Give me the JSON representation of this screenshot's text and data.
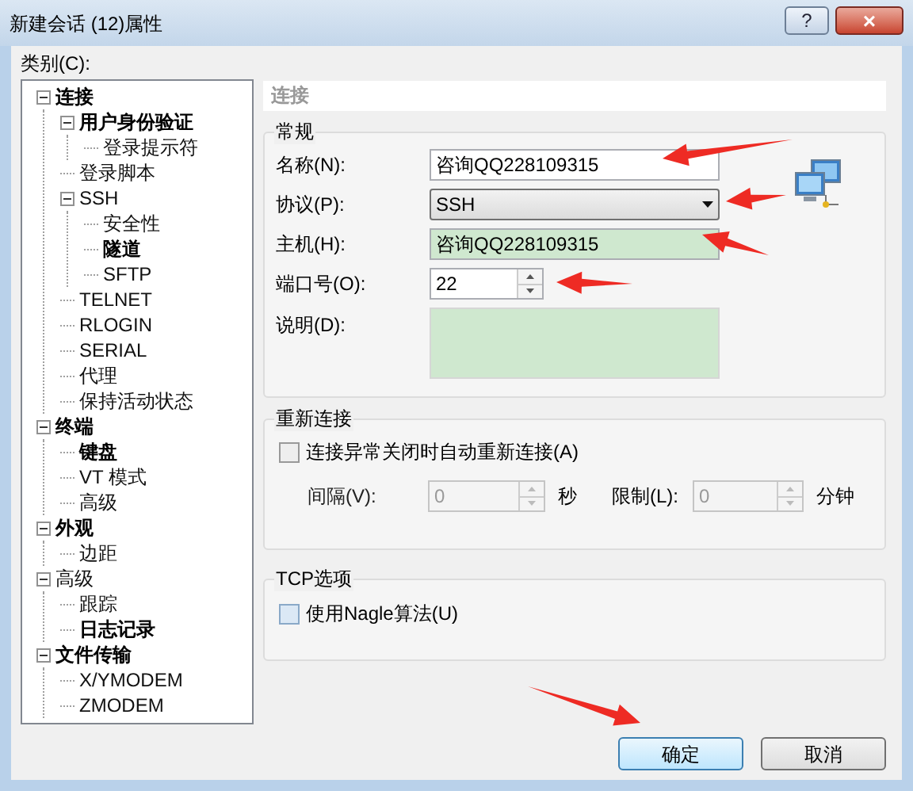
{
  "window": {
    "title": "新建会话 (12)属性",
    "help_button": "?",
    "close_button": "×"
  },
  "category_label": "类别(C):",
  "tree": [
    {
      "label": "连接",
      "bold": true,
      "expanded": true,
      "children": [
        {
          "label": "用户身份验证",
          "bold": true,
          "expanded": true,
          "children": [
            {
              "label": "登录提示符",
              "bold": false
            }
          ]
        },
        {
          "label": "登录脚本",
          "bold": false
        },
        {
          "label": "SSH",
          "bold": false,
          "expanded": true,
          "children": [
            {
              "label": "安全性",
              "bold": false
            },
            {
              "label": "隧道",
              "bold": true
            },
            {
              "label": "SFTP",
              "bold": false
            }
          ]
        },
        {
          "label": "TELNET",
          "bold": false
        },
        {
          "label": "RLOGIN",
          "bold": false
        },
        {
          "label": "SERIAL",
          "bold": false
        },
        {
          "label": "代理",
          "bold": false
        },
        {
          "label": "保持活动状态",
          "bold": false
        }
      ]
    },
    {
      "label": "终端",
      "bold": true,
      "expanded": true,
      "children": [
        {
          "label": "键盘",
          "bold": true
        },
        {
          "label": "VT 模式",
          "bold": false
        },
        {
          "label": "高级",
          "bold": false
        }
      ]
    },
    {
      "label": "外观",
      "bold": true,
      "expanded": true,
      "children": [
        {
          "label": "边距",
          "bold": false
        }
      ]
    },
    {
      "label": "高级",
      "bold": false,
      "expanded": true,
      "children": [
        {
          "label": "跟踪",
          "bold": false
        },
        {
          "label": "日志记录",
          "bold": true
        }
      ]
    },
    {
      "label": "文件传输",
      "bold": true,
      "expanded": true,
      "children": [
        {
          "label": "X/YMODEM",
          "bold": false
        },
        {
          "label": "ZMODEM",
          "bold": false
        }
      ]
    }
  ],
  "panel_title": "连接",
  "general": {
    "title": "常规",
    "name": {
      "label": "名称(N):",
      "value": "咨询QQ228109315"
    },
    "protocol": {
      "label": "协议(P):",
      "value": "SSH"
    },
    "host": {
      "label": "主机(H):",
      "value": "咨询QQ228109315"
    },
    "port": {
      "label": "端口号(O):",
      "value": "22"
    },
    "description": {
      "label": "说明(D):"
    }
  },
  "reconnect": {
    "title": "重新连接",
    "checkbox": {
      "label": "连接异常关闭时自动重新连接(A)",
      "checked": false
    },
    "interval": {
      "label": "间隔(V):",
      "value": "0",
      "unit": "秒",
      "disabled": true
    },
    "limit": {
      "label": "限制(L):",
      "value": "0",
      "unit": "分钟",
      "disabled": true
    }
  },
  "tcp": {
    "title": "TCP选项",
    "checkbox": {
      "label": "使用Nagle算法(U)",
      "checked": false
    }
  },
  "buttons": [
    {
      "label": "确定",
      "default": true
    },
    {
      "label": "取消",
      "default": false
    }
  ]
}
